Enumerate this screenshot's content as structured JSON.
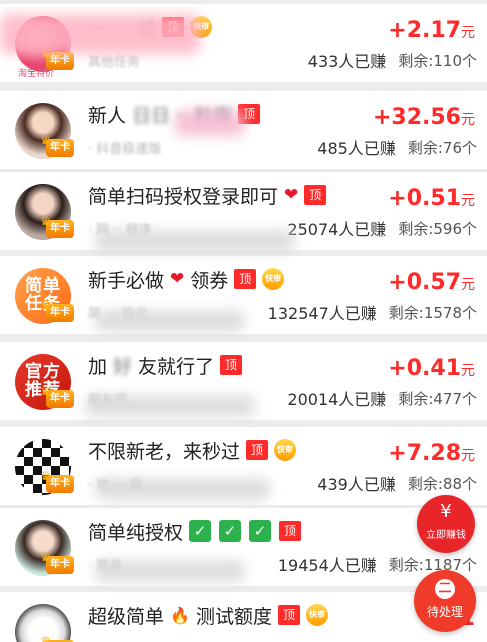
{
  "badges": {
    "nianka": "年卡",
    "ding": "顶",
    "kuaishen": "快审",
    "avatar_tag": "淘宝特价"
  },
  "tasks": [
    {
      "title_visible": "",
      "title_blurred": "一 ··· 过",
      "subtitle": "其他任务",
      "reward": "+2.17",
      "unit": "元",
      "earned": "433人已赚",
      "remaining": "剩余:110个",
      "avatar_style": "pink-blur",
      "avatar_text": "",
      "extras": [
        "ding",
        "kuaishen"
      ]
    },
    {
      "title_visible": "新人",
      "title_blurred": "日日 ·· 秒审",
      "subtitle": "· 抖音极速版",
      "reward": "+32.56",
      "unit": "元",
      "earned": "485人已赚",
      "remaining": "剩余:76个",
      "avatar_style": "girl",
      "avatar_text": "",
      "extras": [
        "ding"
      ]
    },
    {
      "title_visible": "简单扫码授权登录即可",
      "title_blurred": "",
      "subtitle": "· 网 ·· 程序",
      "reward": "+0.51",
      "unit": "元",
      "earned": "25074人已赚",
      "remaining": "剩余:596个",
      "avatar_style": "girl-phone",
      "avatar_text": "",
      "extras": [
        "heart",
        "ding"
      ]
    },
    {
      "title_visible": "新手必做",
      "title_blurred": "",
      "title_after": "领券",
      "subtitle": "简 ··· 指北",
      "reward": "+0.57",
      "unit": "元",
      "earned": "132547人已赚",
      "remaining": "剩余:1578个",
      "avatar_style": "orange",
      "avatar_text": "简单\n任务",
      "extras": [
        "heart-mid",
        "ding",
        "kuaishen"
      ]
    },
    {
      "title_visible": "加",
      "title_blurred": "好",
      "title_after": "友就行了",
      "subtitle": "朋友吧",
      "reward": "+0.41",
      "unit": "元",
      "earned": "20014人已赚",
      "remaining": "剩余:477个",
      "avatar_style": "red",
      "avatar_text": "官方\n推荐",
      "extras": [
        "ding"
      ]
    },
    {
      "title_visible": "不限新老，来秒过",
      "title_blurred": "",
      "subtitle": "· 地 ··· 版",
      "reward": "+7.28",
      "unit": "元",
      "earned": "439人已赚",
      "remaining": "剩余:88个",
      "avatar_style": "checker",
      "avatar_text": "",
      "extras": [
        "ding",
        "kuaishen"
      ]
    },
    {
      "title_visible": "简单纯授权",
      "title_blurred": "",
      "subtitle": "· 简单",
      "reward": "",
      "unit": "",
      "earned": "19454人已赚",
      "remaining": "剩余:1187个",
      "avatar_style": "girl2",
      "avatar_text": "",
      "extras": [
        "checks",
        "ding"
      ]
    },
    {
      "title_visible": "超级简单",
      "title_blurred": "",
      "title_after": "测试额度",
      "subtitle": "",
      "reward": "+1",
      "unit": "",
      "earned": "",
      "remaining": "",
      "avatar_style": "dog",
      "avatar_text": "",
      "extras": [
        "fire-mid",
        "ding",
        "kuaishen"
      ]
    }
  ],
  "float_earn": {
    "label": "立即赚钱",
    "icon": "¥"
  },
  "float_pending": {
    "label": "待处理",
    "icon": "二"
  },
  "colors": {
    "accent": "#ff2a2a",
    "ding": "#ff2a2a",
    "check": "#2bb24c",
    "bg": "#ececec"
  }
}
